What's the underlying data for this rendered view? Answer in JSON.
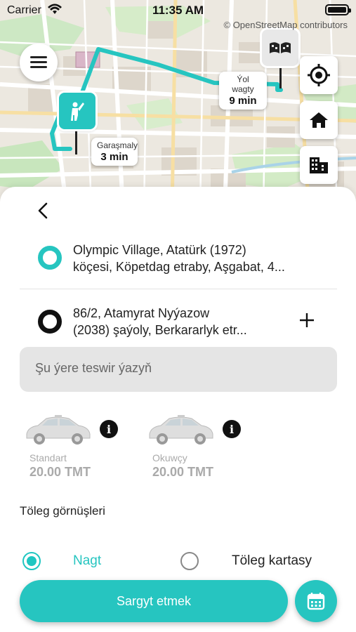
{
  "status_bar": {
    "carrier": "Carrier",
    "time": "11:35 AM"
  },
  "map": {
    "attribution": "© OpenStreetMap contributors",
    "route_color": "#26c5c0",
    "pickup_eta": {
      "label": "Garaşmaly",
      "value": "3 min"
    },
    "trip_eta": {
      "label": "Ýol wagty",
      "value": "9 min"
    },
    "icons": {
      "menu": "menu-icon",
      "locate": "locate-icon",
      "home": "home-icon",
      "work": "building-icon",
      "pickup": "person-waving-icon",
      "destination": "checkered-flag-icon"
    }
  },
  "sheet": {
    "from_address": {
      "line1": "Olympic Village, Atatürk (1972)",
      "line2": "köçesi, Köpetdag etraby, Aşgabat, 4..."
    },
    "to_address": {
      "line1": "86/2, Atamyrat Nyýazow",
      "line2": "(2038) şaýoly, Berkararlyk etr..."
    },
    "description_placeholder": "Şu ýere teswir ýazyň",
    "cars": [
      {
        "name": "Standart",
        "price": "20.00 TMT"
      },
      {
        "name": "Okuwçy",
        "price": "20.00 TMT"
      }
    ],
    "payment_title": "Töleg görnüşleri",
    "payment_options": [
      {
        "label": "Nagt",
        "selected": true
      },
      {
        "label": "Töleg kartasy",
        "selected": false
      }
    ],
    "order_button": "Sargyt etmek",
    "accent_color": "#26c5c0"
  }
}
